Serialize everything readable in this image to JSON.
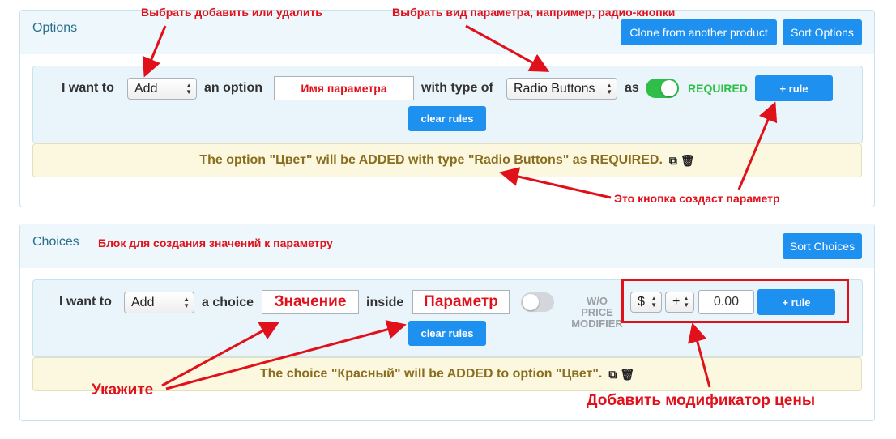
{
  "options": {
    "title": "Options",
    "clone_label": "Clone from another product",
    "sort_label": "Sort Options",
    "row": {
      "i_want_to": "I want to",
      "action_value": "Add",
      "an_option": "an option",
      "name_value": "Имя параметра",
      "with_type_of": "with type of",
      "type_value": "Radio Buttons",
      "as": "as",
      "required_label": "REQUIRED",
      "add_rule_label": "+ rule",
      "clear_rules_label": "clear rules"
    },
    "summary": "The option \"Цвет\" will be ADDED with type \"Radio Buttons\" as REQUIRED."
  },
  "choices": {
    "title": "Choices",
    "sort_label": "Sort Choices",
    "row": {
      "i_want_to": "I want to",
      "action_value": "Add",
      "a_choice": "a choice",
      "choice_value": "Значение",
      "inside": "inside",
      "parameter_value": "Параметр",
      "wo_price_modifier": "W/O PRICE MODIFIER",
      "currency_value": "$",
      "sign_value": "+",
      "price_value": "0.00",
      "add_rule_label": "+ rule",
      "clear_rules_label": "clear rules"
    },
    "summary": "The choice \"Красный\" will be ADDED to option \"Цвет\"."
  },
  "annotations": {
    "select_add_remove": "Выбрать добавить или удалить",
    "select_param_type": "Выбрать вид параметра, например, радио-кнопки",
    "button_creates_param": "Это кнопка создаст параметр",
    "choices_block_hint": "Блок для создания значений к параметру",
    "specify": "Укажите",
    "add_price_modifier": "Добавить модификатор цены"
  },
  "colors": {
    "accent": "#1e90f0",
    "toggle_on": "#2fbf49",
    "required": "#2fbf49",
    "annotation": "#e0111b",
    "summary_text": "#8a6d1e"
  },
  "icons": {
    "copy": "copy-icon",
    "trash": "trash-icon"
  }
}
